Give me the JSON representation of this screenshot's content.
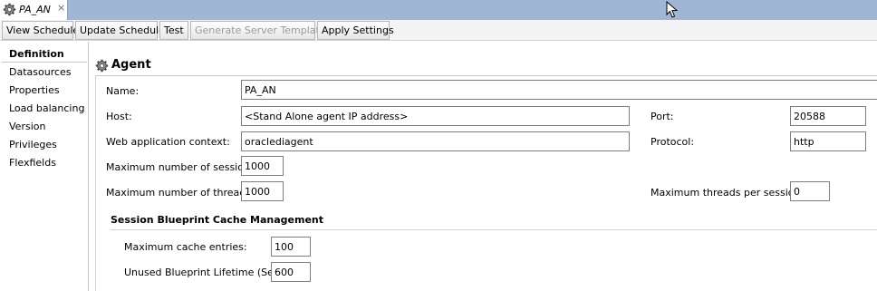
{
  "tab": {
    "title": "PA_AN",
    "close": "×",
    "icon": "gear-icon"
  },
  "toolbar": {
    "view_schedule": "View Schedule",
    "update_schedule": "Update Schedule",
    "test": "Test",
    "generate_server_template": "Generate Server Template",
    "apply_settings": "Apply Settings"
  },
  "sidebar": {
    "items": [
      "Definition",
      "Datasources",
      "Properties",
      "Load balancing",
      "Version",
      "Privileges",
      "Flexfields"
    ],
    "selected": "Definition"
  },
  "section": {
    "title": "Agent",
    "icon": "gear-icon"
  },
  "form": {
    "name_label": "Name:",
    "name_value": "PA_AN",
    "host_label": "Host:",
    "host_value": "<Stand Alone agent IP address>",
    "port_label": "Port:",
    "port_value": "20588",
    "webctx_label": "Web application context:",
    "webctx_value": "oraclediagent",
    "protocol_label": "Protocol:",
    "protocol_value": "http",
    "max_sessions_label": "Maximum number of sessions:",
    "max_sessions_value": "1000",
    "max_threads_label": "Maximum number of threads:",
    "max_threads_value": "1000",
    "max_threads_per_session_label": "Maximum threads per session:",
    "max_threads_per_session_value": "0"
  },
  "cache": {
    "title": "Session Blueprint Cache Management",
    "max_entries_label": "Maximum cache entries:",
    "max_entries_value": "100",
    "lifetime_label": "Unused Blueprint Lifetime (Sec):",
    "lifetime_value": "600"
  }
}
